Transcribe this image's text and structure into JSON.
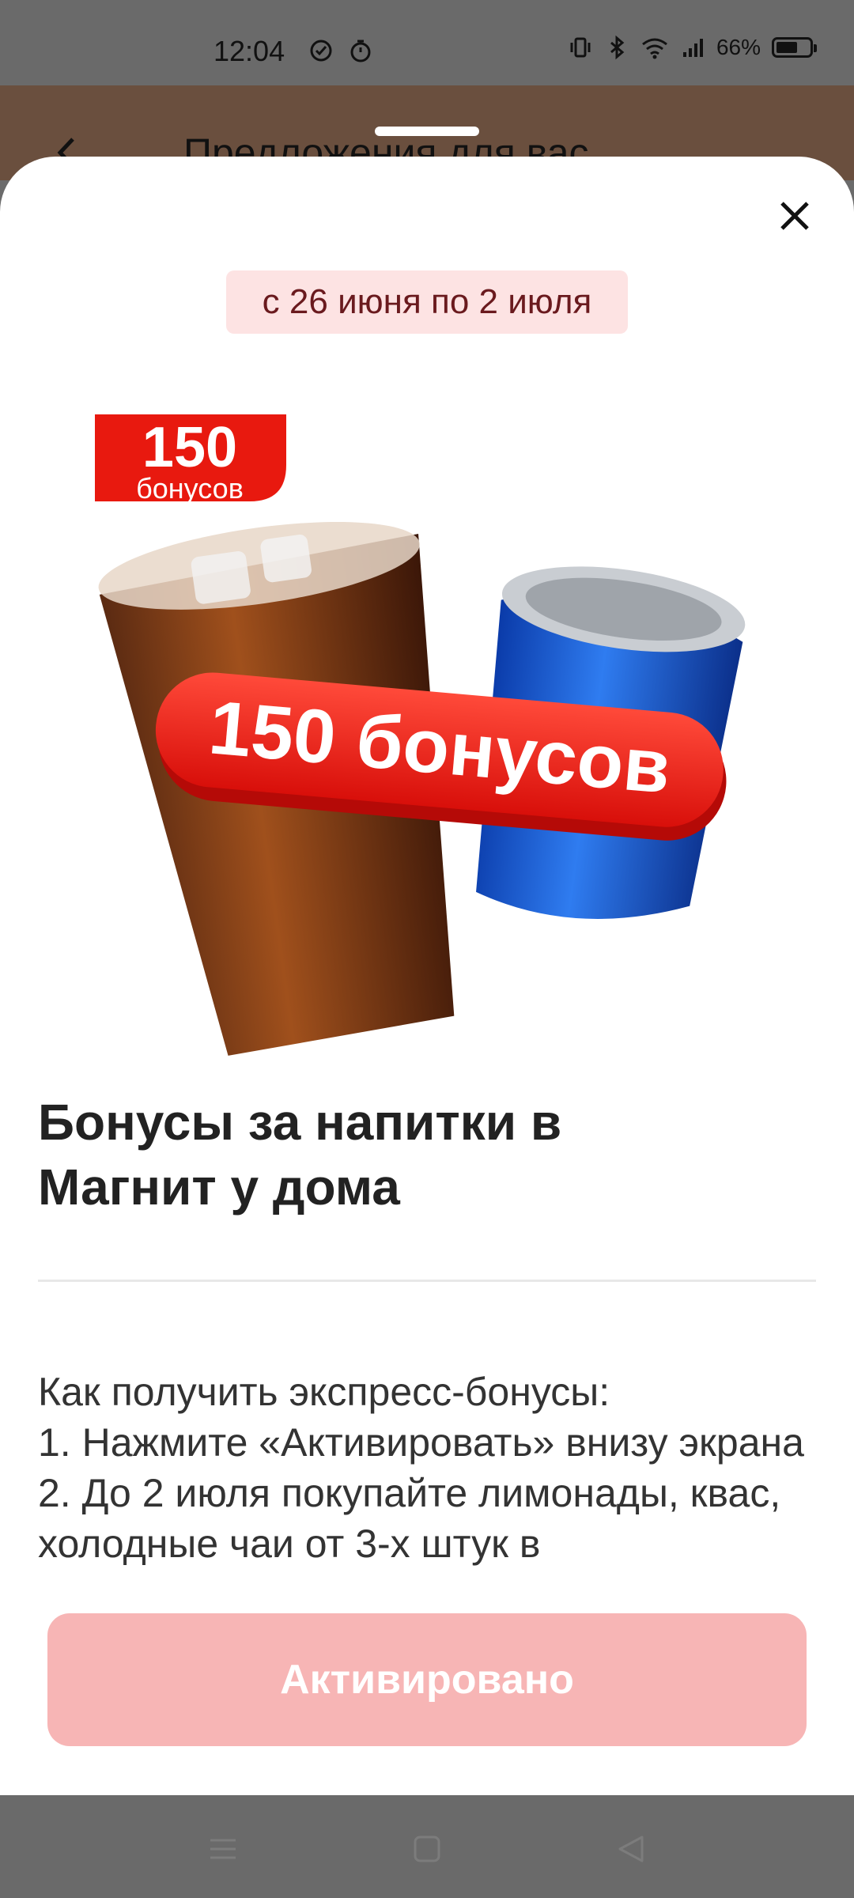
{
  "status_bar": {
    "time": "12:04",
    "battery_percent": "66%",
    "battery_level": 0.66,
    "icons": [
      "check-circle-icon",
      "stopwatch-icon",
      "vibrate-icon",
      "bluetooth-icon",
      "wifi-icon",
      "signal-icon",
      "battery-icon"
    ]
  },
  "background_page": {
    "title": "Предложения для вас"
  },
  "sheet": {
    "date_range": "с 26 июня по 2 июля",
    "badge_value": "150",
    "badge_unit": "бонусов",
    "ribbon_text": "150 бонусов",
    "title": "Бонусы за напитки в Магнит у дома",
    "description": "Как получить экспресс-бонусы:\n1. Нажмите «Активировать» внизу экрана\n2. До 2 июля покупайте лимонады, квас, холодные чаи от 3-х штук в",
    "button_label": "Активировано"
  },
  "colors": {
    "accent_red": "#e8190f",
    "button_disabled": "#f7b5b5",
    "chip_bg": "#fde3e3",
    "chip_text": "#6a1a1e"
  },
  "nav_bar": {
    "icons": [
      "menu-icon",
      "home-square-icon",
      "back-triangle-icon"
    ]
  }
}
